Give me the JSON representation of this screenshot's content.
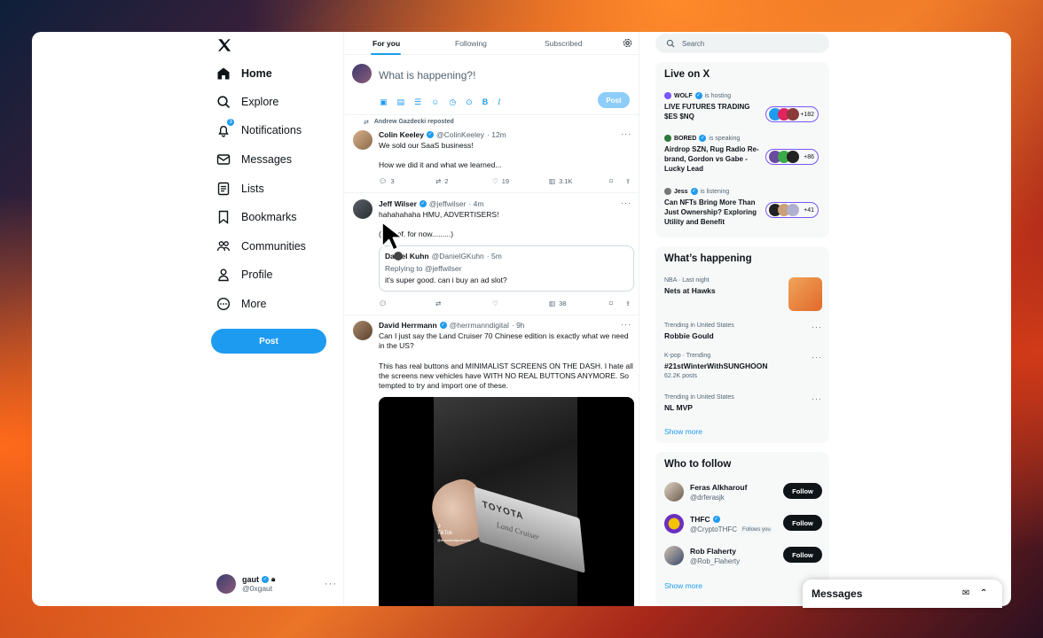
{
  "nav": {
    "items": [
      {
        "label": "Home",
        "icon": "home-icon"
      },
      {
        "label": "Explore",
        "icon": "search-icon"
      },
      {
        "label": "Notifications",
        "icon": "bell-icon"
      },
      {
        "label": "Messages",
        "icon": "mail-icon"
      },
      {
        "label": "Lists",
        "icon": "list-icon"
      },
      {
        "label": "Bookmarks",
        "icon": "bookmark-icon"
      },
      {
        "label": "Communities",
        "icon": "people-icon"
      },
      {
        "label": "Profile",
        "icon": "person-icon"
      },
      {
        "label": "More",
        "icon": "more-circle-icon"
      }
    ],
    "notification_badge": "3",
    "post_label": "Post",
    "user": {
      "name": "gaut",
      "handle": "@0xgaut"
    }
  },
  "tabs": [
    "For you",
    "Following",
    "Subscribed"
  ],
  "compose": {
    "placeholder": "What is happening?!",
    "post_label": "Post"
  },
  "tweets": [
    {
      "repost": "Andrew Gazdecki reposted",
      "name": "Colin Keeley",
      "handle": "@ColinKeeley",
      "time": "· 12m",
      "text": "We sold our SaaS business!",
      "text2": "How we did it and what we learned...",
      "replies": "3",
      "retweets": "2",
      "likes": "19",
      "views": "3.1K"
    },
    {
      "name": "Jeff Wilser",
      "handle": "@jeffwilser",
      "time": "· 4m",
      "text": "hahahahaha HMU, ADVERTISERS!",
      "text2": "(kind of. for now.........)",
      "quote": {
        "name": "Daniel Kuhn",
        "handle": "@DanielGKuhn",
        "time": "· 5m",
        "replying": "Replying to @jeffwilser",
        "text": "it's super good. can i buy an ad slot?"
      },
      "replies": "",
      "retweets": "",
      "likes": "",
      "views": "38"
    },
    {
      "name": "David Herrmann",
      "handle": "@herrmanndigital",
      "time": "· 9h",
      "text": "Can I just say the Land Cruiser 70 Chinese edition is exactly what we need in the US?",
      "text2": "This has real buttons and MINIMALIST SCREENS ON THE DASH. I hate all the screens new vehicles have WITH NO REAL BUTTONS ANYMORE. So tempted to try and import one of these.",
      "video": {
        "tiktok": "TikTok",
        "tiktok_handle": "@droneandjacktoone",
        "brand": "TOYOTA",
        "model": "Land Cruiser"
      }
    }
  ],
  "search": {
    "placeholder": "Search"
  },
  "live": {
    "title": "Live on X",
    "spaces": [
      {
        "host": "WOLF",
        "status": "is hosting",
        "title": "LIVE FUTURES TRADING $ES $NQ",
        "count": "+182"
      },
      {
        "host": "BORED",
        "status": "is speaking",
        "title": "Airdrop SZN, Rug Radio Re-brand, Gordon vs Gabe -Lucky Lead",
        "count": "+86"
      },
      {
        "host": "Jess",
        "status": "is listening",
        "title": "Can NFTs Bring More Than Just Ownership? Exploring Utility and Benefit",
        "count": "+41"
      }
    ]
  },
  "happening": {
    "title": "What’s happening",
    "items": [
      {
        "cat": "NBA · Last night",
        "name": "Nets at Hawks",
        "count": ""
      },
      {
        "cat": "Trending in United States",
        "name": "Robbie Gould",
        "count": ""
      },
      {
        "cat": "K-pop · Trending",
        "name": "#21stWinterWithSUNGHOON",
        "count": "62.2K posts"
      },
      {
        "cat": "Trending in United States",
        "name": "NL MVP",
        "count": ""
      }
    ],
    "show_more": "Show more"
  },
  "who": {
    "title": "Who to follow",
    "items": [
      {
        "name": "Feras Alkharouf",
        "handle": "@drferasjk",
        "follows_you": ""
      },
      {
        "name": "THFC",
        "handle": "@CryptoTHFC",
        "follows_you": "Follows you"
      },
      {
        "name": "Rob Flaherty",
        "handle": "@Rob_Flaherty",
        "follows_you": ""
      }
    ],
    "follow_label": "Follow",
    "show_more": "Show more"
  },
  "messages_drawer": {
    "title": "Messages"
  },
  "colors": {
    "accent": "#1d9bf0",
    "spaces": "#7856ff"
  }
}
